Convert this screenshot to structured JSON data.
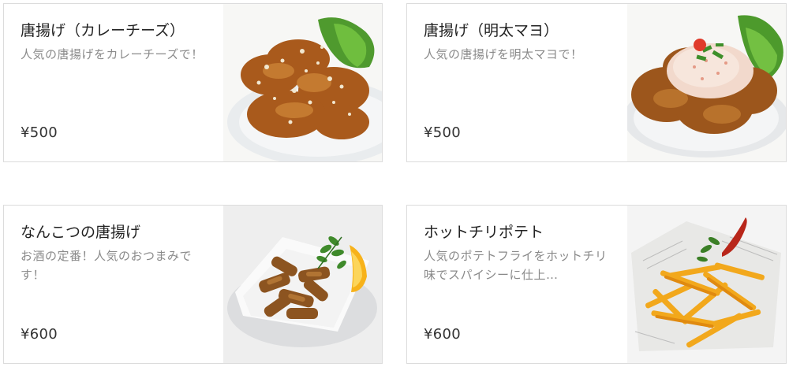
{
  "menu": {
    "items": [
      {
        "name": "唐揚げ（カレーチーズ）",
        "desc": "人気の唐揚げをカレーチーズで！",
        "price": "¥500",
        "image": "karaage-curry-cheese-photo"
      },
      {
        "name": "唐揚げ（明太マヨ）",
        "desc": "人気の唐揚げを明太マヨで！",
        "price": "¥500",
        "image": "karaage-mentai-mayo-photo"
      },
      {
        "name": "なんこつの唐揚げ",
        "desc": "お酒の定番！人気のおつまみです！",
        "price": "¥600",
        "image": "nankotsu-karaage-photo"
      },
      {
        "name": "ホットチリポテト",
        "desc": "人気のポテトフライをホットチリ味でスパイシーに仕上…",
        "price": "¥600",
        "image": "hot-chili-fries-photo"
      }
    ]
  }
}
